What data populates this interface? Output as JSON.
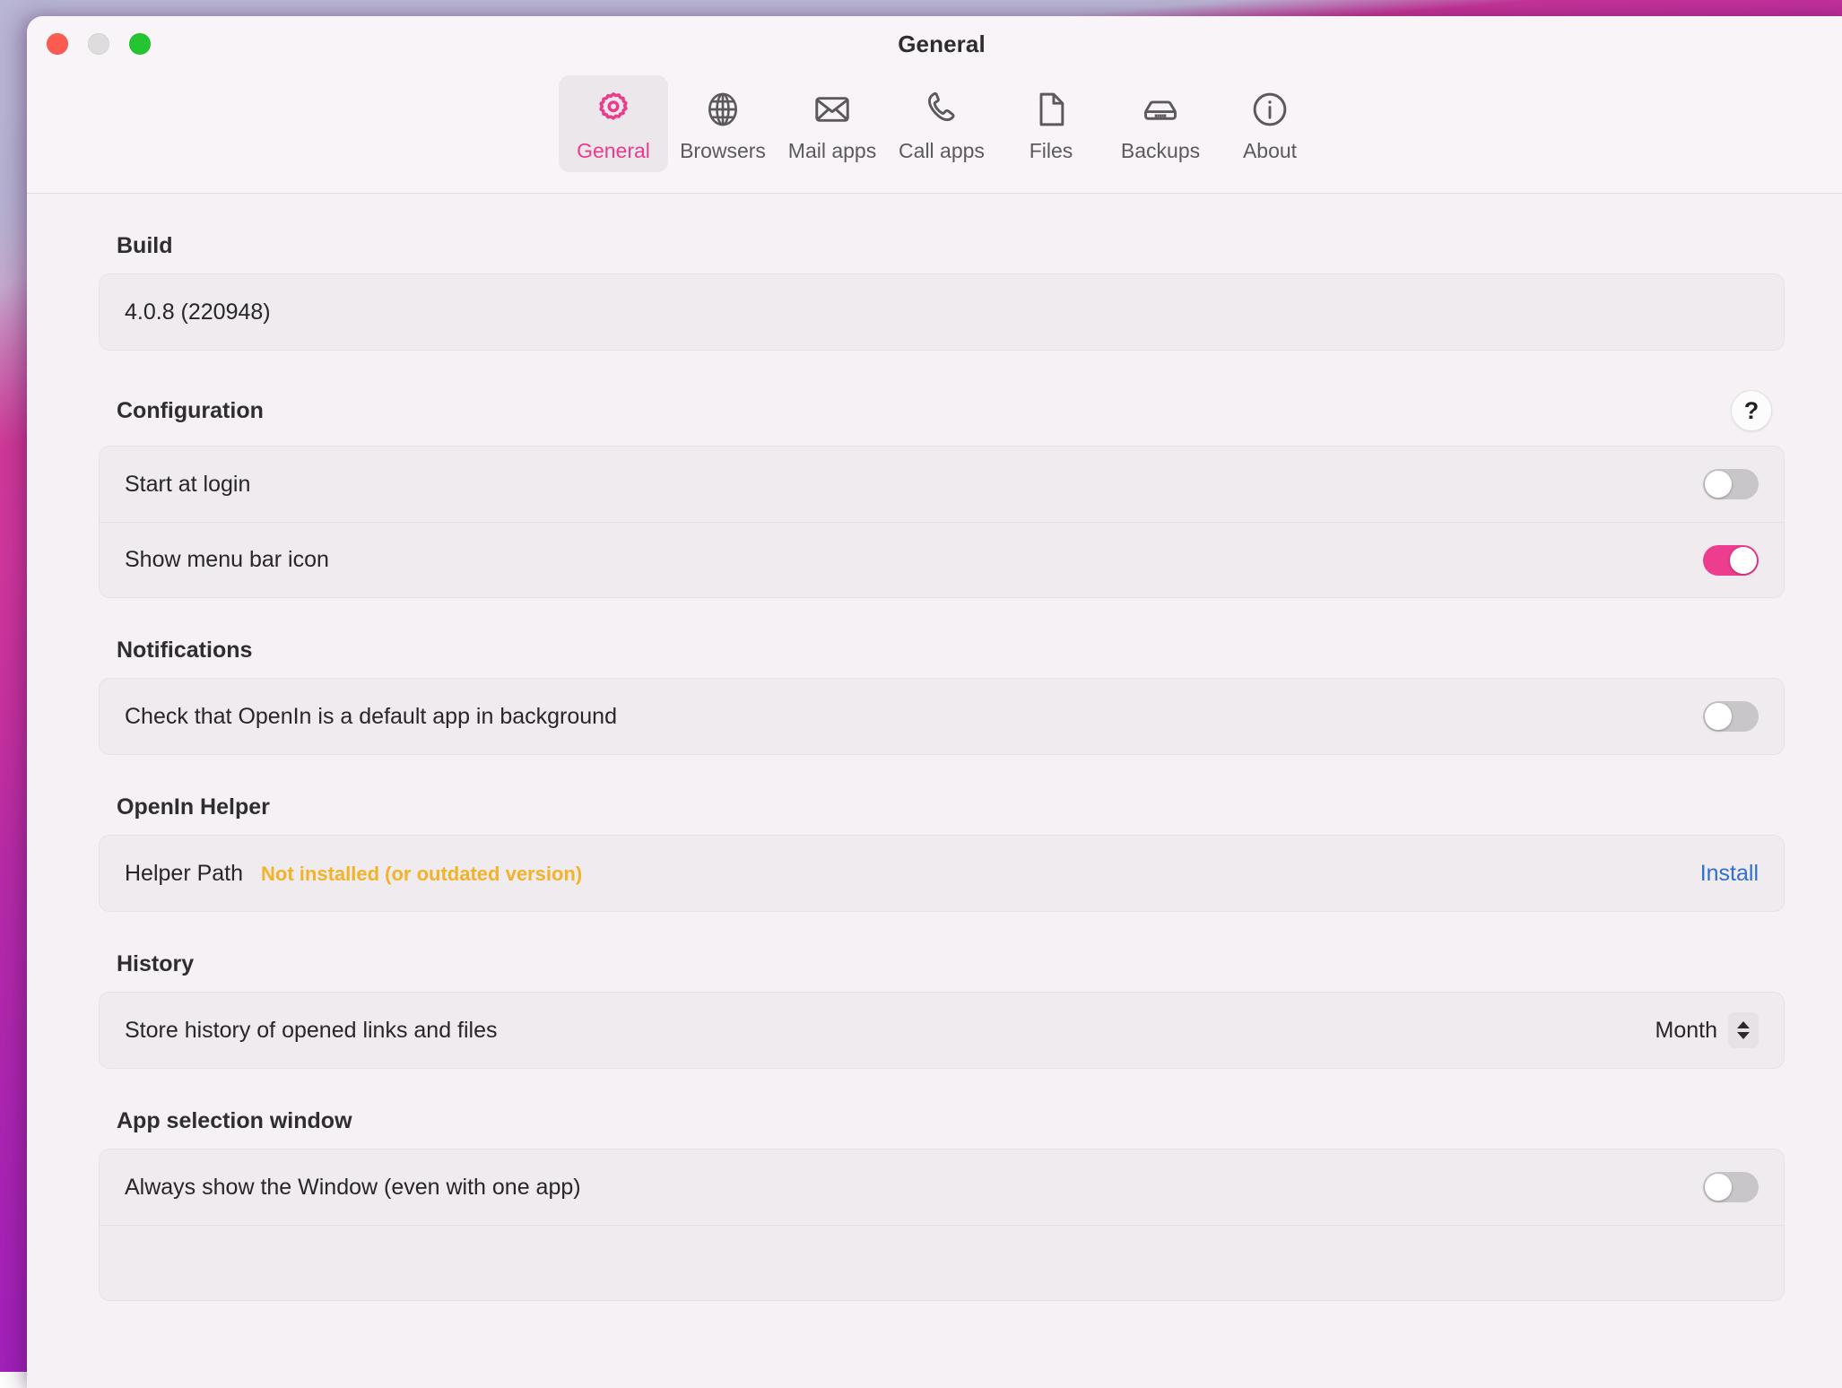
{
  "window": {
    "title": "General",
    "traffic_lights": [
      {
        "name": "close",
        "color": "#fc5b52"
      },
      {
        "name": "minimize",
        "color": "#dedcdd"
      },
      {
        "name": "zoom",
        "color": "#24c530"
      }
    ]
  },
  "toolbar": {
    "tabs": [
      {
        "label": "General",
        "icon": "gear-icon",
        "selected": true
      },
      {
        "label": "Browsers",
        "icon": "globe-icon",
        "selected": false
      },
      {
        "label": "Mail apps",
        "icon": "envelope-icon",
        "selected": false
      },
      {
        "label": "Call apps",
        "icon": "phone-icon",
        "selected": false
      },
      {
        "label": "Files",
        "icon": "document-icon",
        "selected": false
      },
      {
        "label": "Backups",
        "icon": "drive-icon",
        "selected": false
      },
      {
        "label": "About",
        "icon": "info-icon",
        "selected": false
      }
    ]
  },
  "sections": {
    "build": {
      "title": "Build",
      "value": "4.0.8 (220948)"
    },
    "configuration": {
      "title": "Configuration",
      "help_label": "?",
      "rows": [
        {
          "label": "Start at login",
          "toggle": "off"
        },
        {
          "label": "Show menu bar icon",
          "toggle": "on"
        }
      ]
    },
    "notifications": {
      "title": "Notifications",
      "rows": [
        {
          "label": "Check that OpenIn is a default app in background",
          "toggle": "off"
        }
      ]
    },
    "helper": {
      "title": "OpenIn Helper",
      "row_label": "Helper Path",
      "status": "Not installed (or outdated version)",
      "action_label": "Install"
    },
    "history": {
      "title": "History",
      "row_label": "Store history of opened links and files",
      "selected_value": "Month"
    },
    "app_selection": {
      "title": "App selection window",
      "rows": [
        {
          "label": "Always show the Window (even with one app)",
          "toggle": "off"
        }
      ]
    }
  },
  "colors": {
    "accent_pink": "#ec3d8e",
    "link_blue": "#2f6fd0",
    "warning_amber": "#f0b32a",
    "toggle_off": "#c9c6ca",
    "card_bg": "#efebef",
    "page_bg": "#f5f1f5"
  }
}
